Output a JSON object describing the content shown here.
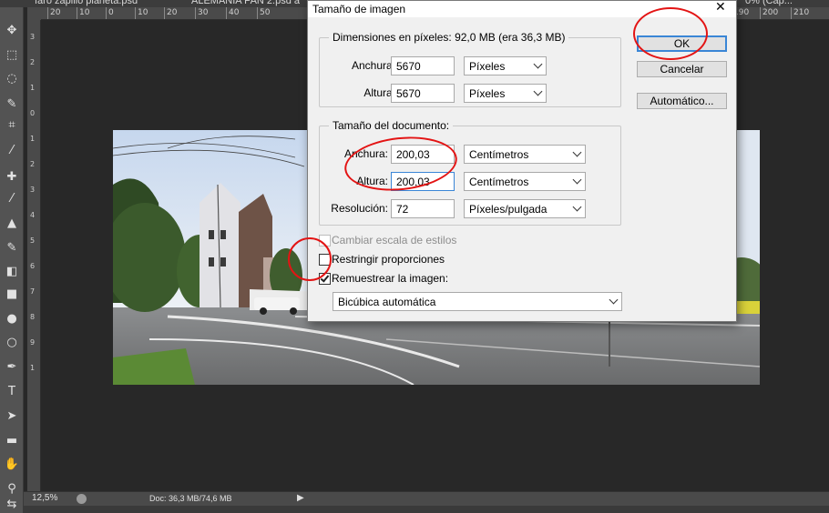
{
  "tabs": [
    {
      "label": "faro zapillo planeta.psd"
    },
    {
      "label": "ALEMANIA PAN 2.psd a"
    },
    {
      "label": "0% (Cap..."
    }
  ],
  "ruler_top": [
    "20",
    "10",
    "0",
    "10",
    "20",
    "30",
    "40",
    "50",
    "190",
    "200",
    "210"
  ],
  "ruler_left": [
    "3",
    "2",
    "1",
    "0",
    "1",
    "2",
    "3",
    "4",
    "5",
    "6",
    "7",
    "8",
    "9",
    "1"
  ],
  "tools": [
    {
      "icon": "move-icon",
      "glyph": "✥"
    },
    {
      "icon": "marquee-icon",
      "glyph": "⬚"
    },
    {
      "icon": "lasso-icon",
      "glyph": "◌"
    },
    {
      "icon": "quick-select-icon",
      "glyph": "✎"
    },
    {
      "icon": "crop-icon",
      "glyph": "⌗"
    },
    {
      "icon": "eyedropper-icon",
      "glyph": "⁄"
    },
    {
      "icon": "healing-icon",
      "glyph": "✚"
    },
    {
      "icon": "brush-icon",
      "glyph": "⁄"
    },
    {
      "icon": "stamp-icon",
      "glyph": "▲"
    },
    {
      "icon": "history-brush-icon",
      "glyph": "✎"
    },
    {
      "icon": "eraser-icon",
      "glyph": "◧"
    },
    {
      "icon": "gradient-icon",
      "glyph": "■"
    },
    {
      "icon": "blur-icon",
      "glyph": "●"
    },
    {
      "icon": "dodge-icon",
      "glyph": "○"
    },
    {
      "icon": "pen-icon",
      "glyph": "✒"
    },
    {
      "icon": "type-icon",
      "glyph": "T"
    },
    {
      "icon": "path-select-icon",
      "glyph": "➤"
    },
    {
      "icon": "shape-icon",
      "glyph": "▬"
    },
    {
      "icon": "hand-icon",
      "glyph": "✋"
    },
    {
      "icon": "zoom-icon",
      "glyph": "⚲"
    },
    {
      "icon": "swap-colors-icon",
      "glyph": "⇆"
    }
  ],
  "status": {
    "zoom": "12,5%",
    "doc_info": "Doc: 36,3 MB/74,6 MB"
  },
  "dialog": {
    "title": "Tamaño de imagen",
    "pixel_dims": {
      "legend": "Dimensiones en píxeles: 92,0 MB (era 36,3 MB)",
      "width_label": "Anchura:",
      "width_value": "5670",
      "width_unit": "Píxeles",
      "height_label": "Altura:",
      "height_value": "5670",
      "height_unit": "Píxeles"
    },
    "doc_size": {
      "legend": "Tamaño del documento:",
      "width_label": "Anchura:",
      "width_value": "200,03",
      "width_unit": "Centímetros",
      "height_label": "Altura:",
      "height_value": "200,03",
      "height_unit": "Centímetros",
      "resolution_label": "Resolución:",
      "resolution_value": "72",
      "resolution_unit": "Píxeles/pulgada"
    },
    "options": {
      "scale_styles": {
        "label": "Cambiar escala de estilos",
        "checked": false,
        "enabled": false
      },
      "constrain": {
        "label": "Restringir proporciones",
        "checked": false,
        "enabled": true
      },
      "resample": {
        "label": "Remuestrear la imagen:",
        "checked": true,
        "enabled": true
      },
      "resample_method": "Bicúbica automática"
    },
    "buttons": {
      "ok": "OK",
      "cancel": "Cancelar",
      "auto": "Automático..."
    }
  },
  "colors": {
    "annotation": "#e31414",
    "focus": "#3a86d6",
    "workspace": "#282828"
  }
}
